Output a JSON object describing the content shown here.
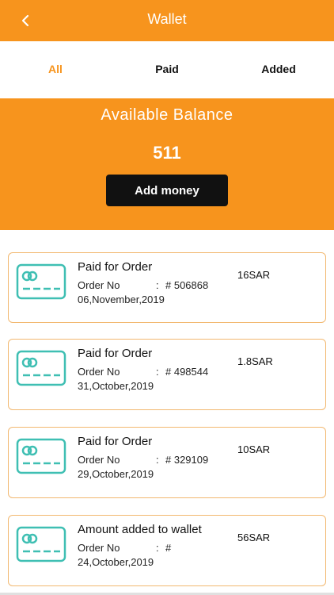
{
  "header": {
    "title": "Wallet",
    "back_icon": "chevron-left-icon"
  },
  "tabs": [
    {
      "label": "All",
      "active": true
    },
    {
      "label": "Paid",
      "active": false
    },
    {
      "label": "Added",
      "active": false
    }
  ],
  "balance": {
    "label": "Available Balance",
    "value": "511",
    "add_button_label": "Add money"
  },
  "colors": {
    "accent": "#f7941d",
    "card_border": "#f2b870",
    "icon_teal": "#3fbfb3",
    "button_dark": "#111111"
  },
  "transactions": [
    {
      "title": "Paid for Order",
      "order_label": "Order No",
      "order_colon": ":",
      "order_number": "# 506868",
      "date": "06,November,2019",
      "amount": "16SAR",
      "icon": "credit-card-icon"
    },
    {
      "title": "Paid for Order",
      "order_label": "Order No",
      "order_colon": ":",
      "order_number": "# 498544",
      "date": "31,October,2019",
      "amount": "1.8SAR",
      "icon": "credit-card-icon"
    },
    {
      "title": "Paid for Order",
      "order_label": "Order No",
      "order_colon": ":",
      "order_number": "# 329109",
      "date": "29,October,2019",
      "amount": "10SAR",
      "icon": "credit-card-icon"
    },
    {
      "title": "Amount added to wallet",
      "order_label": "Order No",
      "order_colon": ":",
      "order_number": "#",
      "date": "24,October,2019",
      "amount": "56SAR",
      "icon": "credit-card-icon"
    }
  ]
}
